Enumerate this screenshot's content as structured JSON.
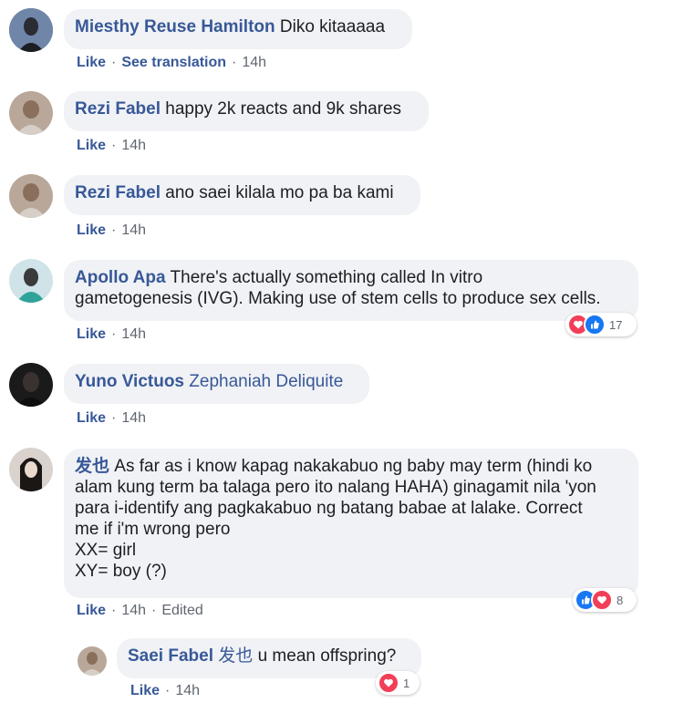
{
  "comments": [
    {
      "name": "Miesthy Reuse Hamilton",
      "text": "Diko kitaaaaa",
      "actions": [
        "Like",
        "See translation",
        "14h"
      ]
    },
    {
      "name": "Rezi Fabel",
      "text": "happy 2k reacts and 9k shares",
      "actions": [
        "Like",
        "14h"
      ]
    },
    {
      "name": "Rezi Fabel",
      "text": "ano saei kilala mo pa ba kami",
      "actions": [
        "Like",
        "14h"
      ]
    },
    {
      "name": "Apollo Apa",
      "text_line1": "There's actually something called In vitro",
      "text_line2": "gametogenesis (IVG). Making use of stem cells to produce sex cells.",
      "actions": [
        "Like",
        "14h"
      ],
      "reaction_count": "17"
    },
    {
      "name": "Yuno Victuos",
      "mention": "Zephaniah Deliquite",
      "actions": [
        "Like",
        "14h"
      ]
    },
    {
      "name": "发也",
      "text_line1": "As far as i know kapag nakakabuo ng baby may term (hindi ko",
      "text_line2": "alam kung term ba talaga pero ito nalang HAHA) ginagamit nila 'yon",
      "text_line3": "para i-identify ang pagkakabuo ng batang babae at lalake. Correct",
      "text_line4": "me if i'm wrong pero",
      "text_line5": "XX= girl",
      "text_line6": "XY= boy (?)",
      "actions": [
        "Like",
        "14h",
        "Edited"
      ],
      "reaction_count": "8"
    }
  ],
  "reply": {
    "name": "Saei Fabel",
    "mention": "发也",
    "text": "u mean offspring?",
    "actions": [
      "Like",
      "14h"
    ],
    "reaction_count": "1"
  },
  "colors": {
    "name": "#385898",
    "bubble": "#f0f2f5",
    "meta": "#606770",
    "heart": "#f33e58",
    "like": "#1877f2",
    "care": "#f7b125"
  }
}
